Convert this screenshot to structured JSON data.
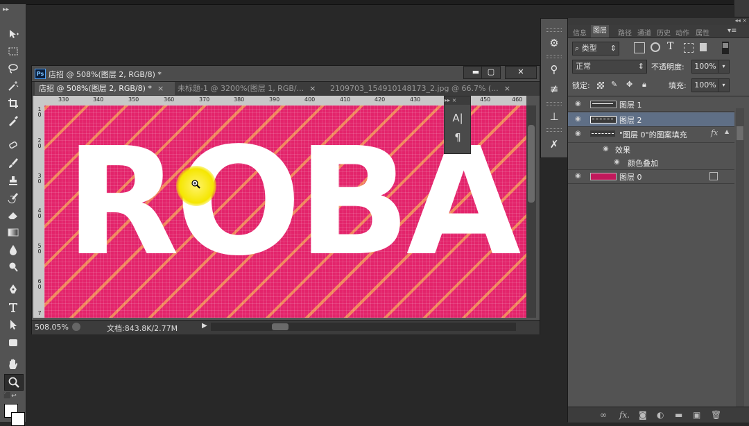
{
  "window": {
    "title": "店招 @ 508%(图层 2, RGB/8) *",
    "ps_badge": "Ps",
    "minimize": "▬",
    "maximize": "▢",
    "close": "✕"
  },
  "tabs": [
    {
      "label": "店招 @ 508%(图层 2, RGB/8) *",
      "close": "×"
    },
    {
      "label": "未标题-1 @ 3200%(图层 1, RGB/...",
      "close": "×"
    },
    {
      "label": "2109703_154910148173_2.jpg @ 66.7% (...",
      "close": "×"
    }
  ],
  "ruler": {
    "h": [
      "330",
      "340",
      "350",
      "360",
      "370",
      "380",
      "390",
      "400",
      "410",
      "420",
      "430",
      "440",
      "450",
      "460"
    ],
    "v": [
      "1\n0",
      "2\n0",
      "3\n0",
      "4\n0",
      "5\n0",
      "6\n0",
      "7"
    ]
  },
  "canvas": {
    "text": "ROBA",
    "colors": {
      "bg": "#e3246b",
      "stripe": "#f0845a",
      "text": "#ffffff"
    }
  },
  "mini_panel": {
    "header": "▸▸ ×",
    "char_icon": "A|",
    "para_icon": "¶"
  },
  "status": {
    "zoom": "508.05%",
    "doc": "文档:843.8K/2.77M",
    "arrow": "▶"
  },
  "toolbar": {
    "collapse": "▸▸"
  },
  "panel": {
    "collapse": "◂◂  ×",
    "tabs": [
      "信息",
      "图层",
      "路径",
      "通道",
      "历史",
      "动作",
      "属性"
    ],
    "active_tab": "图层",
    "filter": {
      "icon": "⌕",
      "label": "类型"
    },
    "blend_mode": "正常",
    "opacity_label": "不透明度:",
    "opacity_value": "100%",
    "lock_label": "锁定:",
    "fill_label": "填充:",
    "fill_value": "100%",
    "layers": [
      {
        "name": "图层 1",
        "selected": false
      },
      {
        "name": "图层 2",
        "selected": true
      },
      {
        "name": "\"图层 0\"的图案填充",
        "selected": false,
        "fx": "fx"
      },
      {
        "name": "效果",
        "selected": false,
        "sub": true
      },
      {
        "name": "颜色叠加",
        "selected": false,
        "sub": true
      },
      {
        "name": "图层 0",
        "selected": false
      }
    ],
    "footer_icons": [
      "link-icon",
      "fx-icon",
      "mask-icon",
      "adjustment-icon",
      "folder-icon",
      "new-layer-icon",
      "trash-icon"
    ]
  }
}
